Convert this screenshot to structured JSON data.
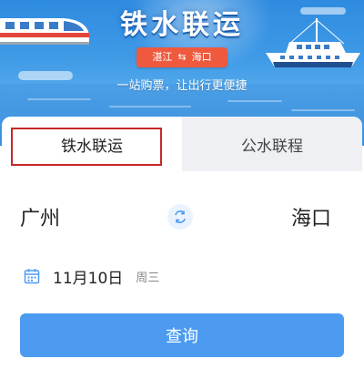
{
  "banner": {
    "title": "铁水联运",
    "route_from": "湛江",
    "route_to": "海口",
    "route_swap_symbol": "⇆",
    "slogan": "一站购票，让出行更便捷"
  },
  "tabs": [
    {
      "label": "铁水联运",
      "active": true
    },
    {
      "label": "公水联程",
      "active": false
    }
  ],
  "journey": {
    "from_city": "广州",
    "to_city": "海口",
    "swap_icon": "swap-icon"
  },
  "date": {
    "icon": "calendar-icon",
    "value": "11月10日",
    "weekday": "周三"
  },
  "query_button": {
    "label": "查询"
  },
  "colors": {
    "accent": "#4c9bf0",
    "pill": "#ef5a3f",
    "highlight_border": "#c62828",
    "banner_sky": "#2f8be0"
  }
}
